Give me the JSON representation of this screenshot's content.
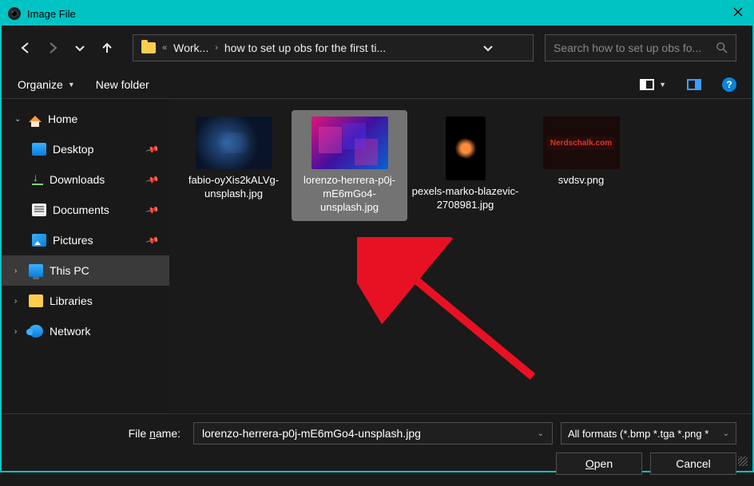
{
  "window": {
    "title": "Image File"
  },
  "breadcrumb": {
    "seg1": "Work...",
    "seg2": "how to set up obs for the first ti..."
  },
  "search": {
    "placeholder": "Search how to set up obs fo..."
  },
  "toolbar": {
    "organize": "Organize",
    "new_folder": "New folder"
  },
  "sidebar": {
    "home": "Home",
    "desktop": "Desktop",
    "downloads": "Downloads",
    "documents": "Documents",
    "pictures": "Pictures",
    "this_pc": "This PC",
    "libraries": "Libraries",
    "network": "Network"
  },
  "files": [
    {
      "name": "fabio-oyXis2kALVg-unsplash.jpg"
    },
    {
      "name": "lorenzo-herrera-p0j-mE6mGo4-unsplash.jpg"
    },
    {
      "name": "pexels-marko-blazevic-2708981.jpg"
    },
    {
      "name": "svdsv.png"
    }
  ],
  "thumb4_text": "Nerdschalk.com",
  "bottom": {
    "filename_label_prefix": "File ",
    "filename_label_u": "n",
    "filename_label_suffix": "ame:",
    "filename_value": "lorenzo-herrera-p0j-mE6mGo4-unsplash.jpg",
    "filetype": "All formats (*.bmp *.tga *.png *",
    "open_u": "O",
    "open_rest": "pen",
    "cancel": "Cancel"
  },
  "help_glyph": "?"
}
